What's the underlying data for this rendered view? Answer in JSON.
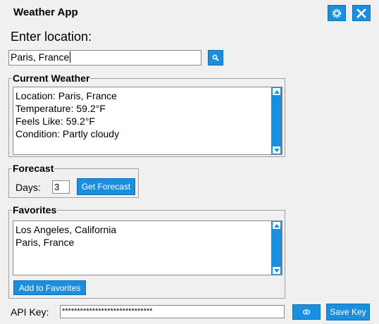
{
  "window": {
    "title": "Weather App"
  },
  "location": {
    "label": "Enter location:",
    "value": "Paris, France"
  },
  "current_weather": {
    "title": "Current Weather",
    "lines": [
      "Location: Paris, France",
      "Temperature: 59.2°F",
      "Feels Like: 59.2°F",
      "Condition: Partly cloudy"
    ]
  },
  "forecast": {
    "title": "Forecast",
    "days_label": "Days:",
    "days_value": "3",
    "button": "Get Forecast"
  },
  "favorites": {
    "title": "Favorites",
    "items": [
      "Los Angeles, California",
      "Paris, France"
    ],
    "add_button": "Add to Favorites"
  },
  "api": {
    "label": "API Key:",
    "value": "******************************",
    "save_button": "Save Key"
  },
  "icons": {
    "settings": "gear-icon",
    "close": "close-icon",
    "search": "search-icon",
    "visibility": "eye-icon"
  },
  "colors": {
    "accent": "#1a8fdf",
    "background": "#f0f0f0"
  }
}
